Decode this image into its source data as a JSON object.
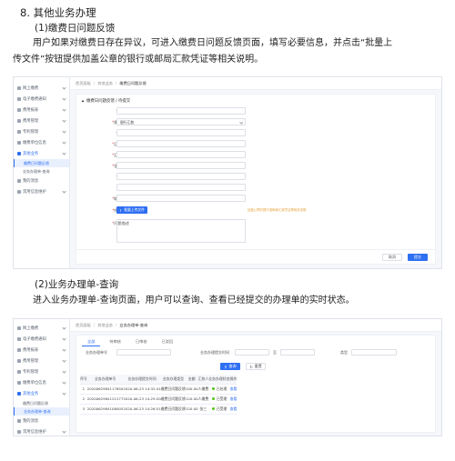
{
  "doc": {
    "section_title": "8. 其他业务办理",
    "sub1": "(1)缴费日问题反馈",
    "para1_line1": "用户如果对缴费日存在异议，可进入缴费日问题反馈页面，填写必要信息，并点击“批量上",
    "para1_line2": "传文件”按钮提供加盖公章的银行或邮局汇款凭证等相关说明。",
    "sub2": "(2)业务办理单-查询",
    "para2": "进入业务办理单-查询页面，用户可以查询、查看已经提交的办理单的实时状态。"
  },
  "sidebar1": {
    "items": [
      {
        "label": "网上缴费"
      },
      {
        "label": "电子缴费通知"
      },
      {
        "label": "费用报表"
      },
      {
        "label": "费用管理"
      },
      {
        "label": "专利管理"
      },
      {
        "label": "缴费单位信息"
      },
      {
        "label": "其他业务"
      }
    ],
    "subs": [
      {
        "label": "缴费日问题反馈"
      },
      {
        "label": "业务办理单-查询"
      }
    ],
    "after": [
      {
        "label": "我的消息"
      },
      {
        "label": "常用信息维护"
      }
    ]
  },
  "shot1": {
    "crumbs": [
      "首页面板",
      "其他业务",
      "缴费日问题反馈"
    ],
    "form_title": "缴费日问题反馈 / 待提交",
    "fields": [
      {
        "label": "申请号",
        "value": "",
        "required": true
      },
      {
        "label": "缴费方式",
        "value": "银行汇款",
        "required": true
      },
      {
        "label": "汇款人",
        "value": "",
        "required": true
      },
      {
        "label": "汇款金额",
        "value": "",
        "required": true
      },
      {
        "label": "汇款日期",
        "value": "",
        "required": true
      },
      {
        "label": "银行账号",
        "value": "",
        "required": true
      },
      {
        "label": "开户行",
        "value": "",
        "required": true
      },
      {
        "label": "联系人",
        "value": "",
        "required": false
      },
      {
        "label": "联系电话",
        "value": "",
        "required": true
      }
    ],
    "upload_label": "附件上传",
    "upload_button": "批量上传文件",
    "upload_tip": "加盖公章的银行或邮局汇款凭证等相关说明",
    "remark_label": "问题描述",
    "cancel_button": "取消",
    "submit_button": "提交"
  },
  "sidebar2": {
    "items": [
      {
        "label": "网上缴费"
      },
      {
        "label": "电子缴费通知"
      },
      {
        "label": "费用报表"
      },
      {
        "label": "费用管理"
      },
      {
        "label": "专利管理"
      },
      {
        "label": "缴费单位信息"
      },
      {
        "label": "其他业务"
      }
    ],
    "subs": [
      {
        "label": "缴费日问题反馈"
      },
      {
        "label": "业务办理单-查询"
      }
    ],
    "after": [
      {
        "label": "我的消息"
      },
      {
        "label": "常用信息维护"
      }
    ]
  },
  "shot2": {
    "crumbs": [
      "首页面板",
      "其他业务",
      "业务办理单-查询"
    ],
    "tabs": [
      "全部",
      "待审核",
      "已审核",
      "已驳回"
    ],
    "filters": {
      "no_label": "业务办理单号",
      "date_label": "业务办理提交时间",
      "date_sep": "至",
      "type_label": "类型"
    },
    "search_button": "查询",
    "reset_button": "重置",
    "columns": [
      "序号",
      "业务办理单号",
      "业务办理提交时间",
      "业务办理类型",
      "金额",
      "汇款人",
      "业务办理状态",
      "操作"
    ],
    "rows": [
      {
        "no": "1",
        "id": "2020062984117650",
        "time": "2020-06-23 14:32:41",
        "type": "缴费日问题反馈",
        "amount": "100.00",
        "payer": "人缴费",
        "status": "已处理",
        "op": "查看",
        "color": "#52c41a"
      },
      {
        "no": "2",
        "id": "2020062984121277",
        "time": "2020-06-23 14:29:20",
        "type": "缴费日问题反馈",
        "amount": "120.00",
        "payer": "人缴费",
        "status": "已受理",
        "op": "查看",
        "color": "#52c41a"
      },
      {
        "no": "3",
        "id": "2020062984108005",
        "time": "2020-06-23 14:26:51",
        "type": "缴费日问题反馈",
        "amount": "120.00",
        "payer": "张三",
        "status": "已受理",
        "op": "查看",
        "color": "#52c41a"
      }
    ]
  }
}
